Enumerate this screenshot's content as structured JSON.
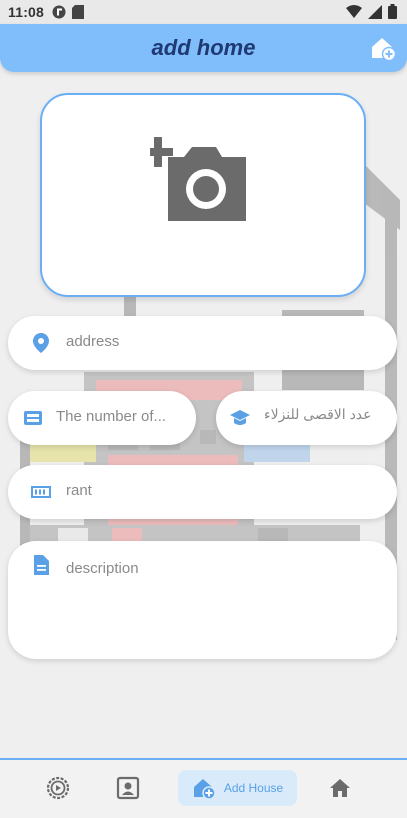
{
  "status_bar": {
    "time": "11:08",
    "left_icons": [
      "app-notification-icon",
      "sd-card-icon"
    ],
    "right_icons": [
      "wifi-icon",
      "signal-icon",
      "battery-icon"
    ]
  },
  "app_bar": {
    "title": "add home",
    "action_icon": "add-home-icon"
  },
  "photo_picker": {
    "icon": "add-photo-camera-icon"
  },
  "form": {
    "address": {
      "placeholder": "address",
      "icon": "location-pin-icon"
    },
    "beds": {
      "placeholder": "The number of...",
      "icon": "bed-icon"
    },
    "max_guests": {
      "placeholder": "عدد الاقصى للنزلاء",
      "icon": "graduation-cap-icon"
    },
    "rent": {
      "placeholder": "rant",
      "icon": "money-icon"
    },
    "description": {
      "placeholder": "description",
      "icon": "document-icon"
    }
  },
  "bottom_nav": {
    "items": [
      {
        "icon": "timer-settings-icon"
      },
      {
        "icon": "contact-card-icon"
      },
      {
        "icon": "add-house-icon",
        "label": "Add House",
        "active": true
      },
      {
        "icon": "home-icon"
      }
    ]
  },
  "colors": {
    "accent": "#80bdfb",
    "title": "#1f3a72",
    "icon_blue": "#5aa0e6"
  }
}
